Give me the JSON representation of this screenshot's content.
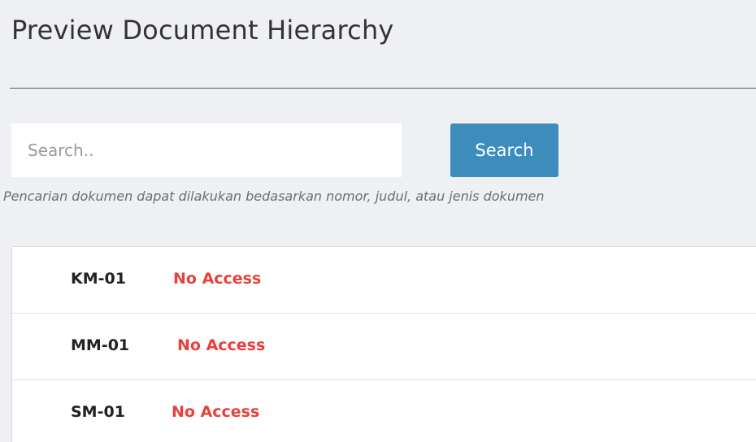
{
  "page": {
    "title": "Preview Document Hierarchy"
  },
  "search": {
    "placeholder": "Search..",
    "button_label": "Search",
    "hint": "Pencarian dokumen dapat dilakukan bedasarkan nomor, judul, atau jenis dokumen"
  },
  "documents": [
    {
      "code": "KM-01",
      "access": "No Access"
    },
    {
      "code": "MM-01",
      "access": "No Access"
    },
    {
      "code": "SM-01",
      "access": "No Access"
    }
  ],
  "colors": {
    "background": "#eef0f3",
    "primary_button": "#3c8dbc",
    "no_access": "#e8403a"
  }
}
